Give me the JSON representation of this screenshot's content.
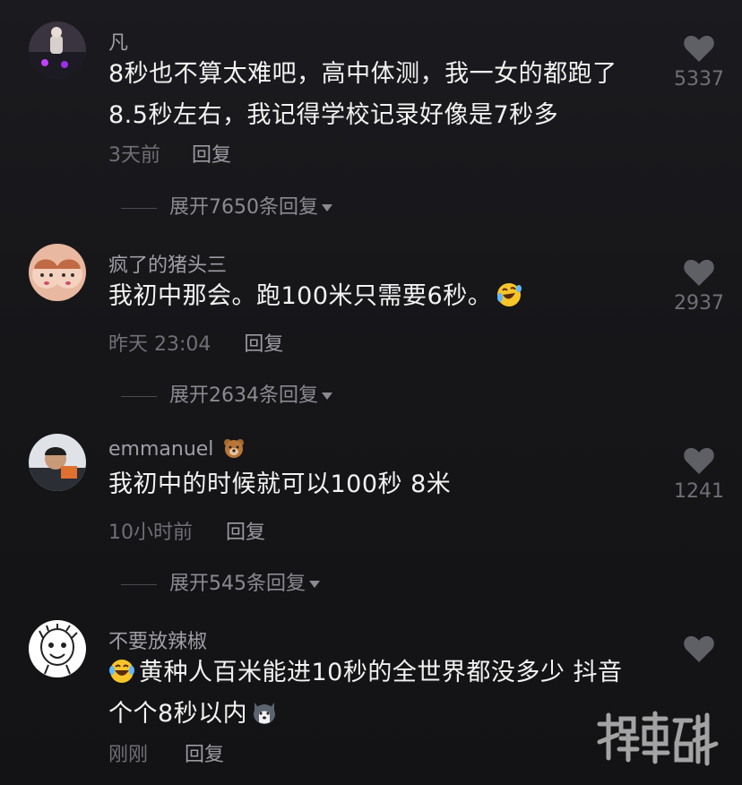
{
  "comments": [
    {
      "username": "凡",
      "text": "8秒也不算太难吧，高中体测，我一女的都跑了8.5秒左右，我记得学校记录好像是7秒多",
      "time": "3天前",
      "reply_label": "回复",
      "likes": "5337",
      "expand_label": "展开7650条回复"
    },
    {
      "username": "疯了的猪头三",
      "text": "我初中那会。跑100米只需要6秒。",
      "time": "昨天 23:04",
      "reply_label": "回复",
      "likes": "2937",
      "expand_label": "展开2634条回复"
    },
    {
      "username": "emmanuel",
      "text": "我初中的时候就可以100秒 8米",
      "time": "10小时前",
      "reply_label": "回复",
      "likes": "1241",
      "expand_label": "展开545条回复"
    },
    {
      "username": "不要放辣椒",
      "text_before": "",
      "text": "黄种人百米能进10秒的全世界都没多少 抖音个个8秒以内",
      "time": "刚刚",
      "reply_label": "回复",
      "likes": ""
    }
  ],
  "watermark": "搜事百科",
  "colors": {
    "background": "#161619",
    "username": "#9e9ea5",
    "text": "#f2f2f2",
    "meta": "#6f6f76"
  }
}
